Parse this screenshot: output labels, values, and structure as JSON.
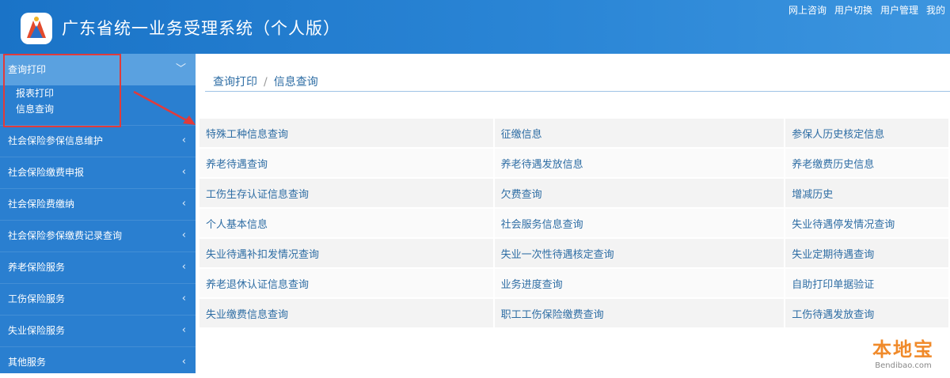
{
  "app": {
    "title": "广东省统一业务受理系统（个人版）"
  },
  "top_actions": [
    "网上咨询",
    "用户切换",
    "用户管理",
    "我的"
  ],
  "sidebar": {
    "groups": [
      {
        "label": "查询打印",
        "active": true,
        "items": [
          "报表打印",
          "信息查询"
        ]
      },
      {
        "label": "社会保险参保信息维护"
      },
      {
        "label": "社会保险缴费申报"
      },
      {
        "label": "社会保险费缴纳"
      },
      {
        "label": "社会保险参保缴费记录查询"
      },
      {
        "label": "养老保险服务"
      },
      {
        "label": "工伤保险服务"
      },
      {
        "label": "失业保险服务"
      },
      {
        "label": "其他服务"
      }
    ]
  },
  "breadcrumb": {
    "parent": "查询打印",
    "separator": "/",
    "current": "信息查询"
  },
  "query_links": [
    [
      "特殊工种信息查询",
      "征缴信息",
      "参保人历史核定信息"
    ],
    [
      "养老待遇查询",
      "养老待遇发放信息",
      "养老缴费历史信息"
    ],
    [
      "工伤生存认证信息查询",
      "欠费查询",
      "增减历史"
    ],
    [
      "个人基本信息",
      "社会服务信息查询",
      "失业待遇停发情况查询"
    ],
    [
      "失业待遇补扣发情况查询",
      "失业一次性待遇核定查询",
      "失业定期待遇查询"
    ],
    [
      "养老退休认证信息查询",
      "业务进度查询",
      "自助打印单据验证"
    ],
    [
      "失业缴费信息查询",
      "职工工伤保险缴费查询",
      "工伤待遇发放查询"
    ]
  ],
  "watermark": {
    "text": "本地宝",
    "sub": "Bendibao.com"
  },
  "colors": {
    "header": "#1a73c7",
    "sidebar": "#2a7fd0",
    "sidebar_active": "#5aa1e0",
    "link": "#2e6da4",
    "annotation": "#e13b3b"
  }
}
